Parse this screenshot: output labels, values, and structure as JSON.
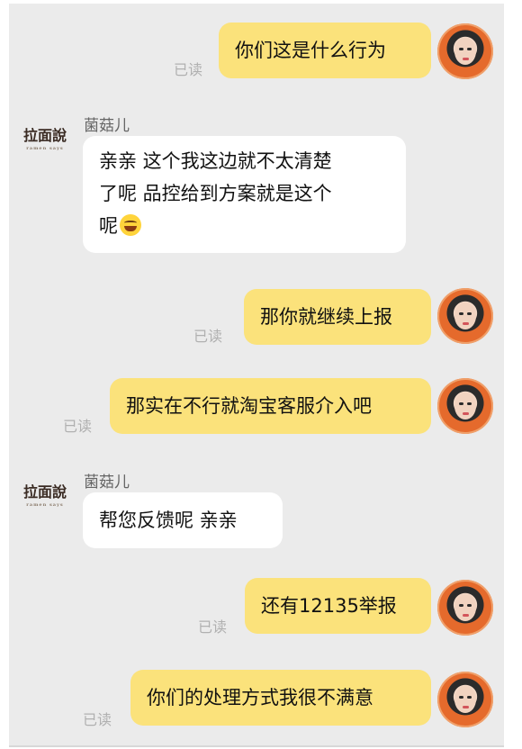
{
  "read_label": "已读",
  "shop": {
    "name": "菌菇儿",
    "logo_text": "拉面說",
    "logo_sub": "ramen says"
  },
  "messages": [
    {
      "dir": "out",
      "text": "你们这是什么行为"
    },
    {
      "dir": "in",
      "lines": [
        "亲亲  这个我这边就不太清楚",
        "了呢  品控给到方案就是这个",
        "呢"
      ],
      "emoji": "grinning-sweat-emoji"
    },
    {
      "dir": "out",
      "text": "那你就继续上报"
    },
    {
      "dir": "out",
      "text": "那实在不行就淘宝客服介入吧"
    },
    {
      "dir": "in",
      "text": "帮您反馈呢  亲亲"
    },
    {
      "dir": "out",
      "text": "还有12135举报"
    },
    {
      "dir": "out",
      "text": "你们的处理方式我很不满意"
    }
  ],
  "colors": {
    "outgoing_bubble": "#fbe27b",
    "incoming_bubble": "#ffffff",
    "background": "#ebebeb",
    "read_text": "#b0b0b0"
  }
}
